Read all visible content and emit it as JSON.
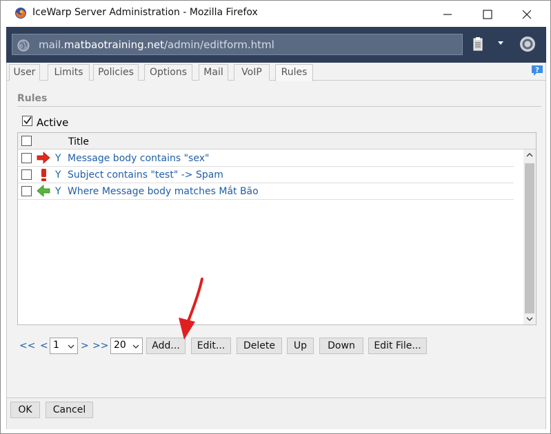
{
  "window": {
    "title": "IceWarp Server Administration - Mozilla Firefox",
    "url_prefix": "mail.",
    "url_host": "matbaotraining.net",
    "url_path": "/admin/editform.html"
  },
  "tabs": [
    {
      "label": "User"
    },
    {
      "label": "Limits"
    },
    {
      "label": "Policies"
    },
    {
      "label": "Options"
    },
    {
      "label": "Mail"
    },
    {
      "label": "VoIP"
    },
    {
      "label": "Rules"
    }
  ],
  "active_tab": "Rules",
  "section": {
    "title": "Rules"
  },
  "active_checkbox": {
    "label": "Active",
    "checked": true
  },
  "grid": {
    "columns": [
      "Title"
    ],
    "rows": [
      {
        "icon": "right-arrow-icon",
        "flag": "Y",
        "title": "Message body contains \"sex\""
      },
      {
        "icon": "exclamation-icon",
        "flag": "Y",
        "title": "Subject contains \"test\" -> Spam"
      },
      {
        "icon": "left-arrow-icon",
        "flag": "Y",
        "title": "Where Message body matches Mắt Bão"
      }
    ]
  },
  "pager": {
    "first": "<<",
    "prev": "<",
    "page": "1",
    "next": ">",
    "last": ">>",
    "page_size": "20"
  },
  "buttons": {
    "add": "Add...",
    "edit": "Edit...",
    "delete": "Delete",
    "up": "Up",
    "down": "Down",
    "edit_file": "Edit File..."
  },
  "footer": {
    "ok": "OK",
    "cancel": "Cancel"
  },
  "colors": {
    "link": "#1f5fa8",
    "annotation": "#e02020",
    "address_bar": "#2f3e58"
  }
}
